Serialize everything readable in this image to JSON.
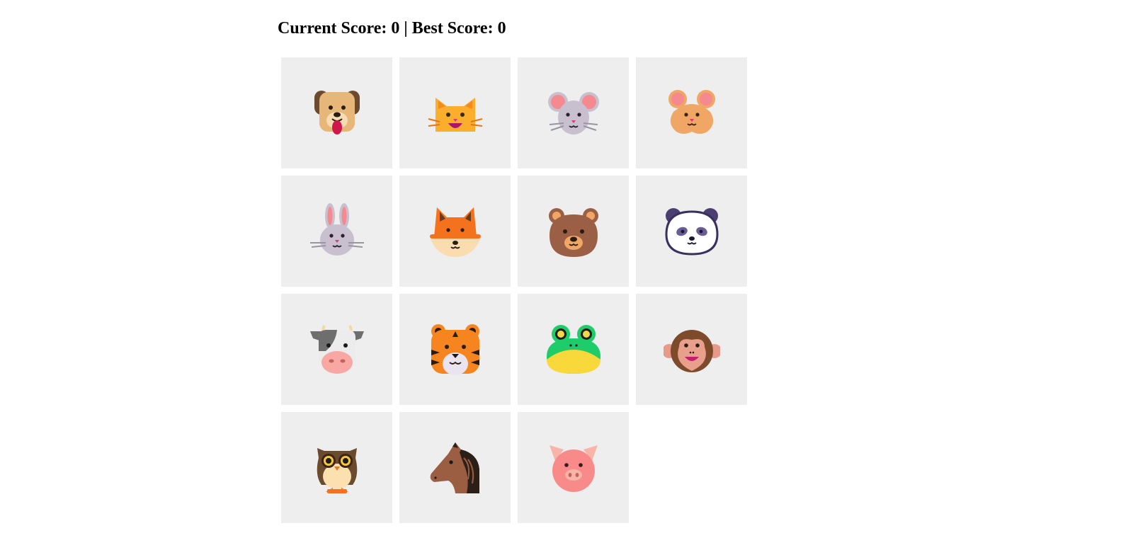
{
  "scoreboard": {
    "current_label": "Current Score:",
    "current_value": "0",
    "separator": "|",
    "best_label": "Best Score:",
    "best_value": "0"
  },
  "cards": [
    {
      "animal": "dog-icon"
    },
    {
      "animal": "cat-icon"
    },
    {
      "animal": "mouse-icon"
    },
    {
      "animal": "hamster-icon"
    },
    {
      "animal": "rabbit-icon"
    },
    {
      "animal": "fox-icon"
    },
    {
      "animal": "bear-icon"
    },
    {
      "animal": "panda-icon"
    },
    {
      "animal": "cow-icon"
    },
    {
      "animal": "tiger-icon"
    },
    {
      "animal": "frog-icon"
    },
    {
      "animal": "monkey-icon"
    },
    {
      "animal": "owl-icon"
    },
    {
      "animal": "horse-icon"
    },
    {
      "animal": "pig-icon"
    }
  ],
  "colors": {
    "card_background": "#eeeeee",
    "page_background": "#ffffff",
    "text": "#000000"
  }
}
